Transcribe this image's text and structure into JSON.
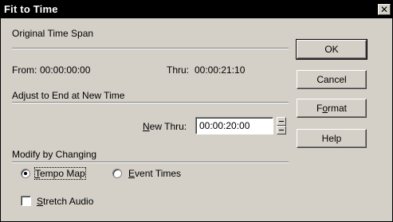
{
  "window": {
    "title": "Fit to Time",
    "close_glyph": "✕"
  },
  "original": {
    "heading": "Original Time Span",
    "from_label": "From:",
    "from_value": "00:00:00:00",
    "thru_label": "Thru:",
    "thru_value": "00:00:21:10"
  },
  "adjust": {
    "heading": "Adjust to End at New Time",
    "new_thru_label_rest": "ew Thru:",
    "new_thru_accel": "N",
    "new_thru_value": "00:00:20:00"
  },
  "modify": {
    "heading": "Modify by Changing",
    "tempo_map_accel": "T",
    "tempo_map_rest": "empo Map",
    "tempo_map_selected": true,
    "event_times_accel": "E",
    "event_times_rest": "vent Times",
    "event_times_selected": false,
    "stretch_accel": "S",
    "stretch_rest": "tretch Audio",
    "stretch_checked": false
  },
  "buttons": {
    "ok": "OK",
    "cancel": "Cancel",
    "format_accel": "o",
    "format_pre": "F",
    "format_post": "rmat",
    "help": "Help"
  }
}
